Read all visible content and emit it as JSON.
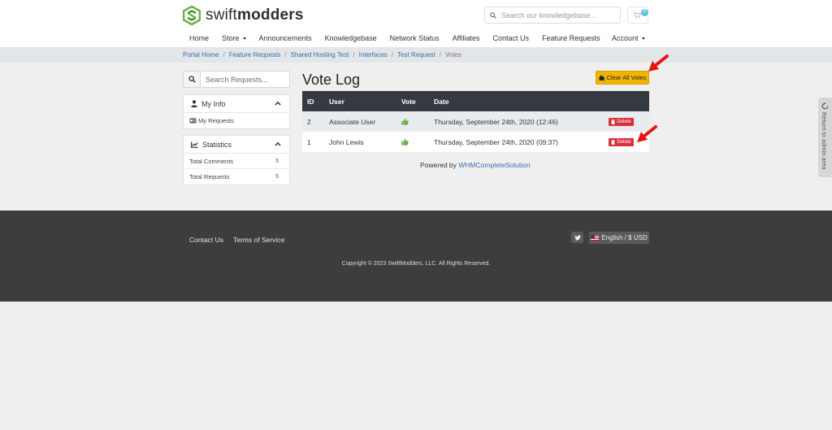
{
  "brand": {
    "name_light": "swift",
    "name_bold": "modders",
    "logo_color": "#6ab04c"
  },
  "header": {
    "search_placeholder": "Search our knowledgebase...",
    "cart_count": "0"
  },
  "nav": {
    "items": [
      "Home",
      "Store",
      "Announcements",
      "Knowledgebase",
      "Network Status",
      "Affiliates",
      "Contact Us",
      "Feature Requests"
    ],
    "account": "Account"
  },
  "breadcrumb": [
    "Portal Home",
    "Feature Requests",
    "Shared Hosting Test",
    "Interfaces",
    "Test Request",
    "Votes"
  ],
  "sidebar": {
    "search_placeholder": "Search Requests...",
    "myinfo": {
      "title": "My Info",
      "items": [
        "My Requests"
      ]
    },
    "stats": {
      "title": "Statistics",
      "rows": [
        {
          "label": "Total Comments",
          "count": "5"
        },
        {
          "label": "Total Requests",
          "count": "5"
        }
      ]
    }
  },
  "main": {
    "title": "Vote Log",
    "clear_button": "Clear All Votes",
    "columns": [
      "ID",
      "User",
      "Vote",
      "Date"
    ],
    "rows": [
      {
        "id": "2",
        "user": "Associate User",
        "date": "Thursday, September 24th, 2020 (12:46)",
        "action": "Delete"
      },
      {
        "id": "1",
        "user": "John Lewis",
        "date": "Thursday, September 24th, 2020 (09:37)",
        "action": "Delete"
      }
    ],
    "powered_prefix": "Powered by",
    "powered_link": "WHMCompleteSolution"
  },
  "admin_tab": "Return to admin area",
  "footer": {
    "links": [
      "Contact Us",
      "Terms of Service"
    ],
    "language": "English / $ USD",
    "copyright": "Copyright © 2023 SwiftModders, LLC. All Rights Reserved."
  },
  "colors": {
    "accent_yellow": "#f0b400",
    "danger": "#d9303c",
    "table_head": "#343a40",
    "footer": "#3d3d3d",
    "arrow": "#e8140e"
  }
}
